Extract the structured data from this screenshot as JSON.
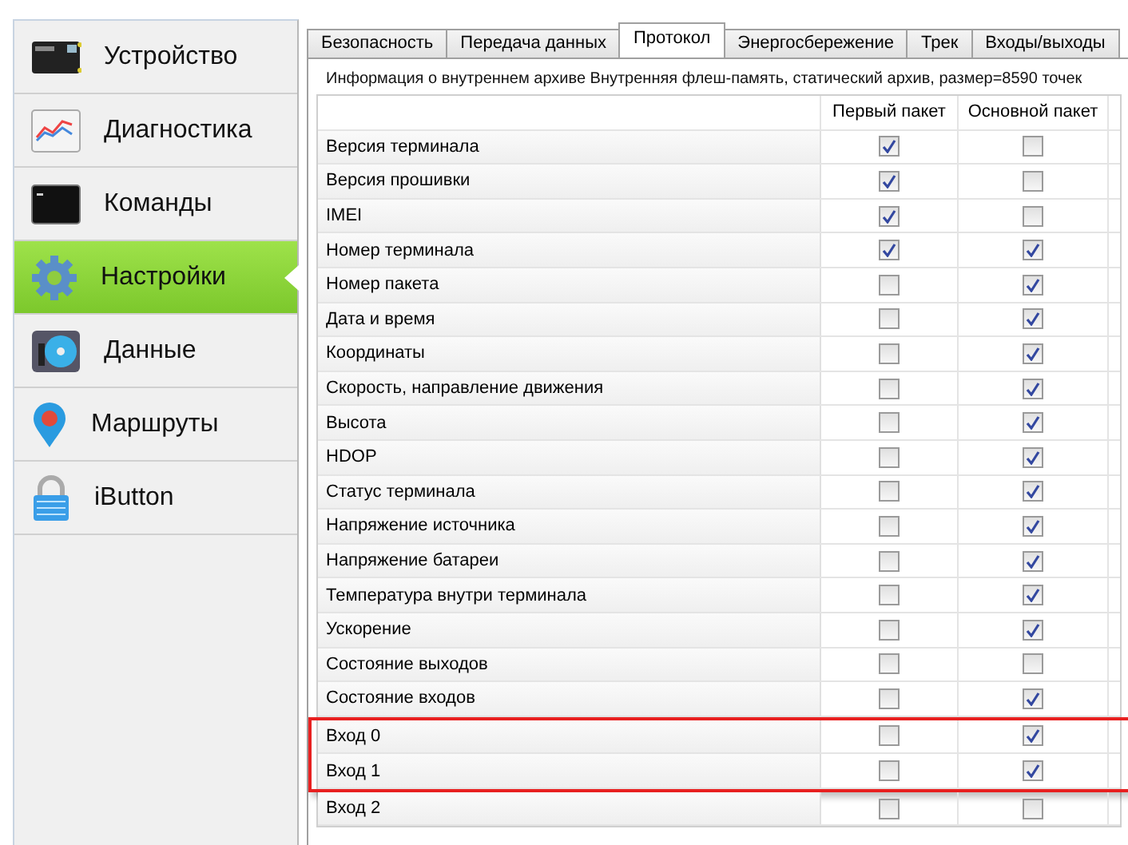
{
  "sidebar": {
    "items": [
      {
        "label": "Устройство",
        "kind": "device",
        "selected": false
      },
      {
        "label": "Диагностика",
        "kind": "chart",
        "selected": false
      },
      {
        "label": "Команды",
        "kind": "terminal",
        "selected": false
      },
      {
        "label": "Настройки",
        "kind": "gear",
        "selected": true
      },
      {
        "label": "Данные",
        "kind": "disk",
        "selected": false
      },
      {
        "label": "Маршруты",
        "kind": "pin",
        "selected": false
      },
      {
        "label": "iButton",
        "kind": "lock",
        "selected": false
      }
    ]
  },
  "tabs": [
    {
      "label": "Безопасность",
      "selected": false
    },
    {
      "label": "Передача данных",
      "selected": false
    },
    {
      "label": "Протокол",
      "selected": true
    },
    {
      "label": "Энергосбережение",
      "selected": false
    },
    {
      "label": "Трек",
      "selected": false
    },
    {
      "label": "Входы/выходы",
      "selected": false
    }
  ],
  "info": "Информация о внутреннем архиве  Внутренняя флеш-память, статический архив, размер=8590 точек",
  "table": {
    "columns": [
      "Первый пакет",
      "Основной пакет"
    ],
    "rows": [
      {
        "name": "Версия терминала",
        "first": true,
        "main": false,
        "highlighted": false
      },
      {
        "name": "Версия прошивки",
        "first": true,
        "main": false,
        "highlighted": false
      },
      {
        "name": "IMEI",
        "first": true,
        "main": false,
        "highlighted": false
      },
      {
        "name": "Номер терминала",
        "first": true,
        "main": true,
        "highlighted": false
      },
      {
        "name": "Номер пакета",
        "first": false,
        "main": true,
        "highlighted": false
      },
      {
        "name": "Дата и время",
        "first": false,
        "main": true,
        "highlighted": false
      },
      {
        "name": "Координаты",
        "first": false,
        "main": true,
        "highlighted": false
      },
      {
        "name": "Скорость, направление движения",
        "first": false,
        "main": true,
        "highlighted": false
      },
      {
        "name": "Высота",
        "first": false,
        "main": true,
        "highlighted": false
      },
      {
        "name": "HDOP",
        "first": false,
        "main": true,
        "highlighted": false
      },
      {
        "name": "Статус терминала",
        "first": false,
        "main": true,
        "highlighted": false
      },
      {
        "name": "Напряжение источника",
        "first": false,
        "main": true,
        "highlighted": false
      },
      {
        "name": "Напряжение батареи",
        "first": false,
        "main": true,
        "highlighted": false
      },
      {
        "name": "Температура внутри терминала",
        "first": false,
        "main": true,
        "highlighted": false
      },
      {
        "name": "Ускорение",
        "first": false,
        "main": true,
        "highlighted": false
      },
      {
        "name": "Состояние выходов",
        "first": false,
        "main": false,
        "highlighted": false
      },
      {
        "name": "Состояние входов",
        "first": false,
        "main": true,
        "highlighted": false
      },
      {
        "name": "Вход 0",
        "first": false,
        "main": true,
        "highlighted": true
      },
      {
        "name": "Вход 1",
        "first": false,
        "main": true,
        "highlighted": true
      },
      {
        "name": "Вход 2",
        "first": false,
        "main": false,
        "highlighted": false
      }
    ]
  }
}
